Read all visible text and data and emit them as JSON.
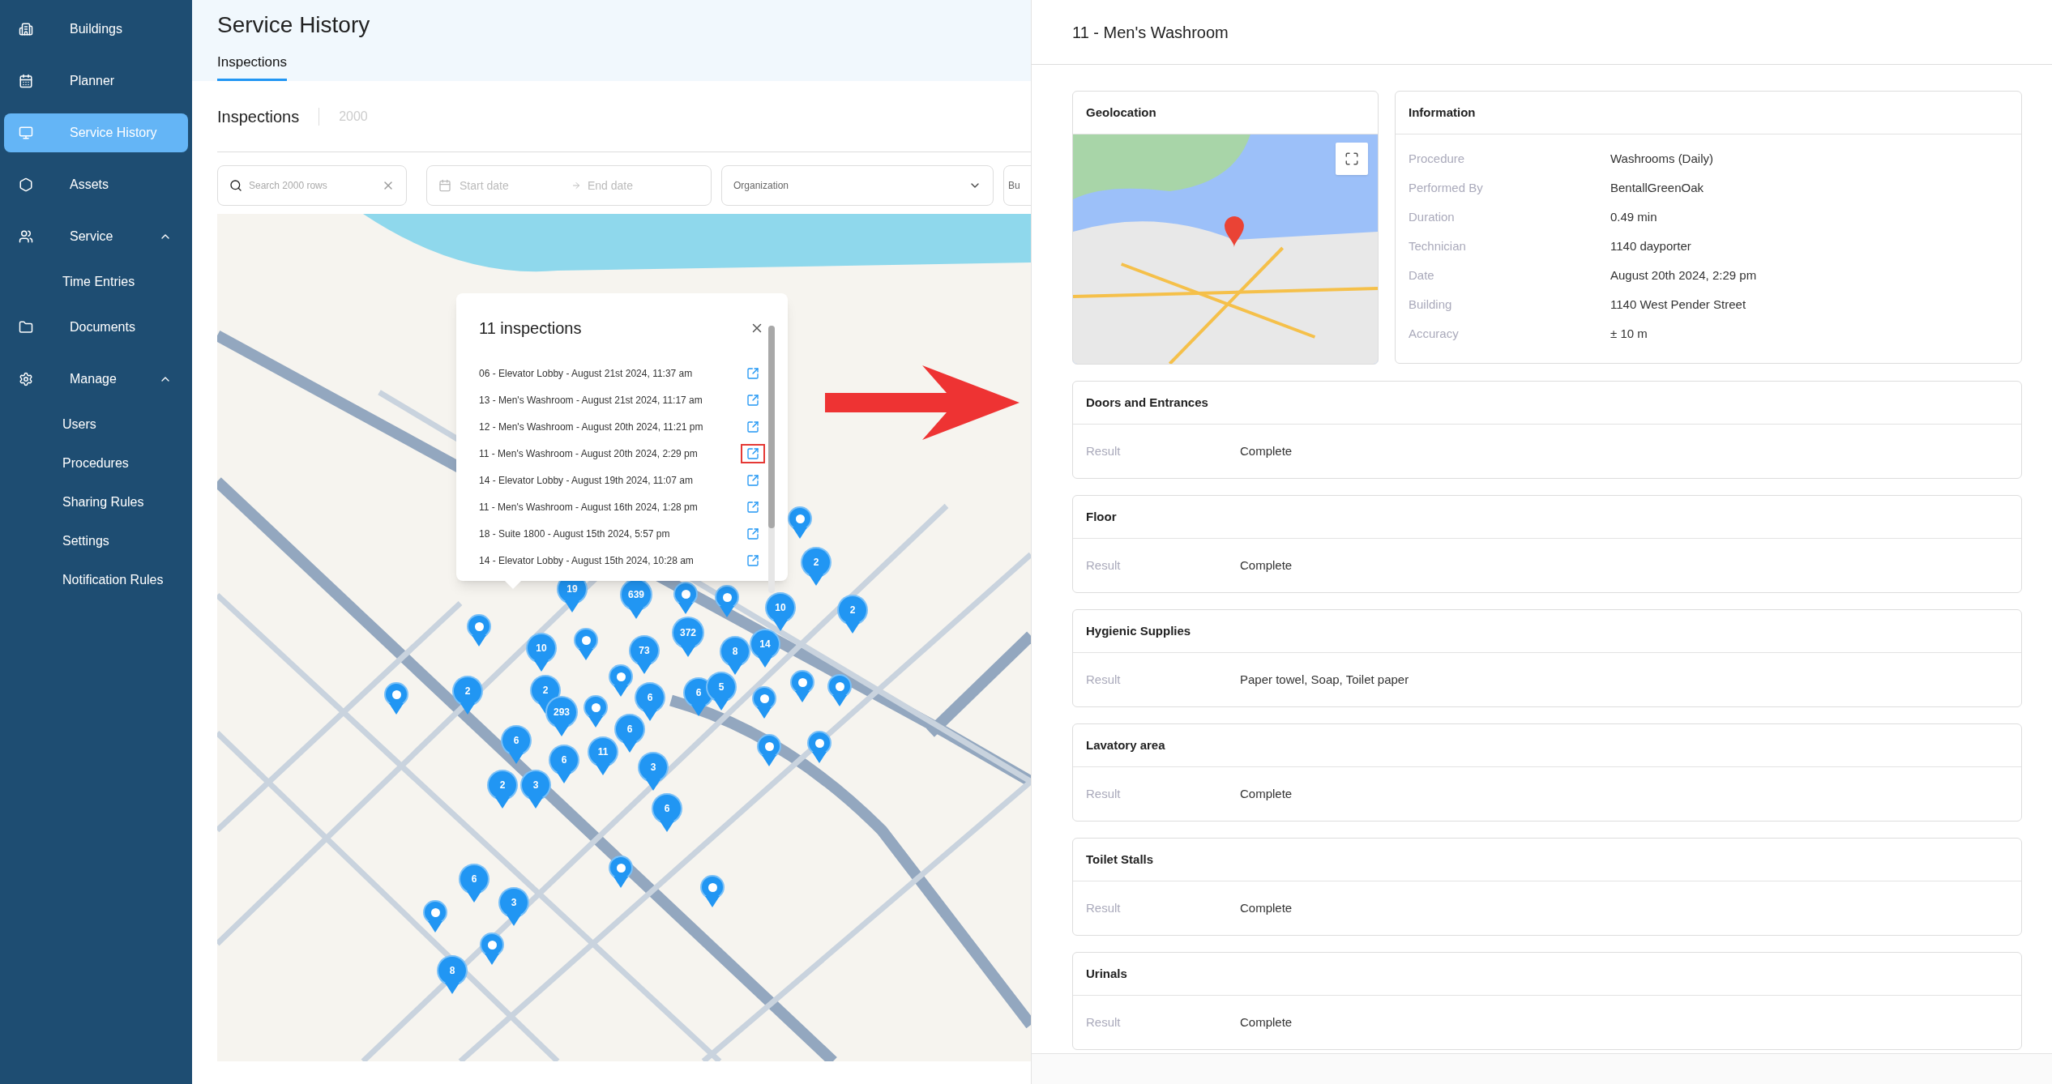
{
  "sidebar": {
    "items": [
      {
        "label": "Buildings",
        "selected": false
      },
      {
        "label": "Planner",
        "selected": false
      },
      {
        "label": "Service History",
        "selected": true
      },
      {
        "label": "Assets",
        "selected": false
      },
      {
        "label": "Service",
        "selected": false,
        "expanded": true,
        "children": [
          {
            "label": "Time Entries",
            "selected": false
          }
        ]
      },
      {
        "label": "Documents",
        "selected": false
      },
      {
        "label": "Manage",
        "selected": false,
        "expanded": true,
        "children": [
          {
            "label": "Users",
            "selected": false
          },
          {
            "label": "Procedures",
            "selected": false
          },
          {
            "label": "Sharing Rules",
            "selected": false
          },
          {
            "label": "Settings",
            "selected": false
          },
          {
            "label": "Notification Rules",
            "selected": false
          }
        ]
      }
    ]
  },
  "page": {
    "title": "Service History",
    "tabs": [
      {
        "label": "Inspections",
        "selected": true
      }
    ]
  },
  "list_header": {
    "title": "Inspections",
    "count": "2000"
  },
  "filters": {
    "search": {
      "placeholder": "Search 2000 rows"
    },
    "start_date": {
      "placeholder": "Start date"
    },
    "end_date": {
      "placeholder": "End date"
    },
    "organization": {
      "placeholder": "Organization"
    },
    "field_4": {
      "placeholder": "Bu"
    }
  },
  "map_markers": [
    {
      "kind": "single"
    },
    {
      "kind": "cluster",
      "count": "2"
    },
    {
      "kind": "cluster",
      "count": "19"
    },
    {
      "kind": "cluster",
      "count": "639"
    },
    {
      "kind": "single"
    },
    {
      "kind": "single"
    },
    {
      "kind": "cluster",
      "count": "10"
    },
    {
      "kind": "cluster",
      "count": "2"
    },
    {
      "kind": "single"
    },
    {
      "kind": "cluster",
      "count": "372"
    },
    {
      "kind": "cluster",
      "count": "10"
    },
    {
      "kind": "single"
    },
    {
      "kind": "cluster",
      "count": "73"
    },
    {
      "kind": "cluster",
      "count": "8"
    },
    {
      "kind": "cluster",
      "count": "14"
    },
    {
      "kind": "single"
    },
    {
      "kind": "single"
    },
    {
      "kind": "cluster",
      "count": "2"
    },
    {
      "kind": "cluster",
      "count": "2"
    },
    {
      "kind": "cluster",
      "count": "6"
    },
    {
      "kind": "cluster",
      "count": "6"
    },
    {
      "kind": "cluster",
      "count": "5"
    },
    {
      "kind": "single"
    },
    {
      "kind": "single"
    },
    {
      "kind": "single"
    },
    {
      "kind": "cluster",
      "count": "293"
    },
    {
      "kind": "single"
    },
    {
      "kind": "cluster",
      "count": "6"
    },
    {
      "kind": "cluster",
      "count": "6"
    },
    {
      "kind": "cluster",
      "count": "6"
    },
    {
      "kind": "cluster",
      "count": "11"
    },
    {
      "kind": "single"
    },
    {
      "kind": "single"
    },
    {
      "kind": "cluster",
      "count": "3"
    },
    {
      "kind": "cluster",
      "count": "2"
    },
    {
      "kind": "cluster",
      "count": "3"
    },
    {
      "kind": "cluster",
      "count": "6"
    },
    {
      "kind": "cluster",
      "count": "6"
    },
    {
      "kind": "single"
    },
    {
      "kind": "single"
    },
    {
      "kind": "single"
    },
    {
      "kind": "cluster",
      "count": "3"
    },
    {
      "kind": "single"
    },
    {
      "kind": "cluster",
      "count": "8"
    }
  ],
  "popup": {
    "title": "11 inspections",
    "items": [
      {
        "text": "06 - Elevator Lobby - August 21st 2024, 11:37 am",
        "highlighted": false
      },
      {
        "text": "13 - Men's Washroom - August 21st 2024, 11:17 am",
        "highlighted": false
      },
      {
        "text": "12 - Men's Washroom - August 20th 2024, 11:21 pm",
        "highlighted": false
      },
      {
        "text": "11 - Men's Washroom - August 20th 2024, 2:29 pm",
        "highlighted": true
      },
      {
        "text": "14 - Elevator Lobby - August 19th 2024, 11:07 am",
        "highlighted": false
      },
      {
        "text": "11 - Men's Washroom - August 16th 2024, 1:28 pm",
        "highlighted": false
      },
      {
        "text": "18 - Suite 1800 - August 15th 2024, 5:57 pm",
        "highlighted": false
      },
      {
        "text": "14 - Elevator Lobby - August 15th 2024, 10:28 am",
        "highlighted": false
      }
    ]
  },
  "detail": {
    "title": "11 - Men's Washroom",
    "geolocation": {
      "title": "Geolocation"
    },
    "information": {
      "title": "Information",
      "rows": [
        {
          "label": "Procedure",
          "value": "Washrooms (Daily)"
        },
        {
          "label": "Performed By",
          "value": "BentallGreenOak"
        },
        {
          "label": "Duration",
          "value": "0.49 min"
        },
        {
          "label": "Technician",
          "value": "1140 dayporter"
        },
        {
          "label": "Date",
          "value": "August 20th 2024, 2:29 pm"
        },
        {
          "label": "Building",
          "value": "1140 West Pender Street"
        },
        {
          "label": "Accuracy",
          "value": "± 10 m"
        }
      ]
    },
    "sections": [
      {
        "title": "Doors and Entrances",
        "rows": [
          {
            "label": "Result",
            "value": "Complete"
          }
        ]
      },
      {
        "title": "Floor",
        "rows": [
          {
            "label": "Result",
            "value": "Complete"
          }
        ]
      },
      {
        "title": "Hygienic Supplies",
        "rows": [
          {
            "label": "Result",
            "value": "Paper towel, Soap, Toilet paper"
          }
        ]
      },
      {
        "title": "Lavatory area",
        "rows": [
          {
            "label": "Result",
            "value": "Complete"
          }
        ]
      },
      {
        "title": "Toilet Stalls",
        "rows": [
          {
            "label": "Result",
            "value": "Complete"
          }
        ]
      },
      {
        "title": "Urinals",
        "rows": [
          {
            "label": "Result",
            "value": "Complete"
          }
        ]
      }
    ]
  }
}
